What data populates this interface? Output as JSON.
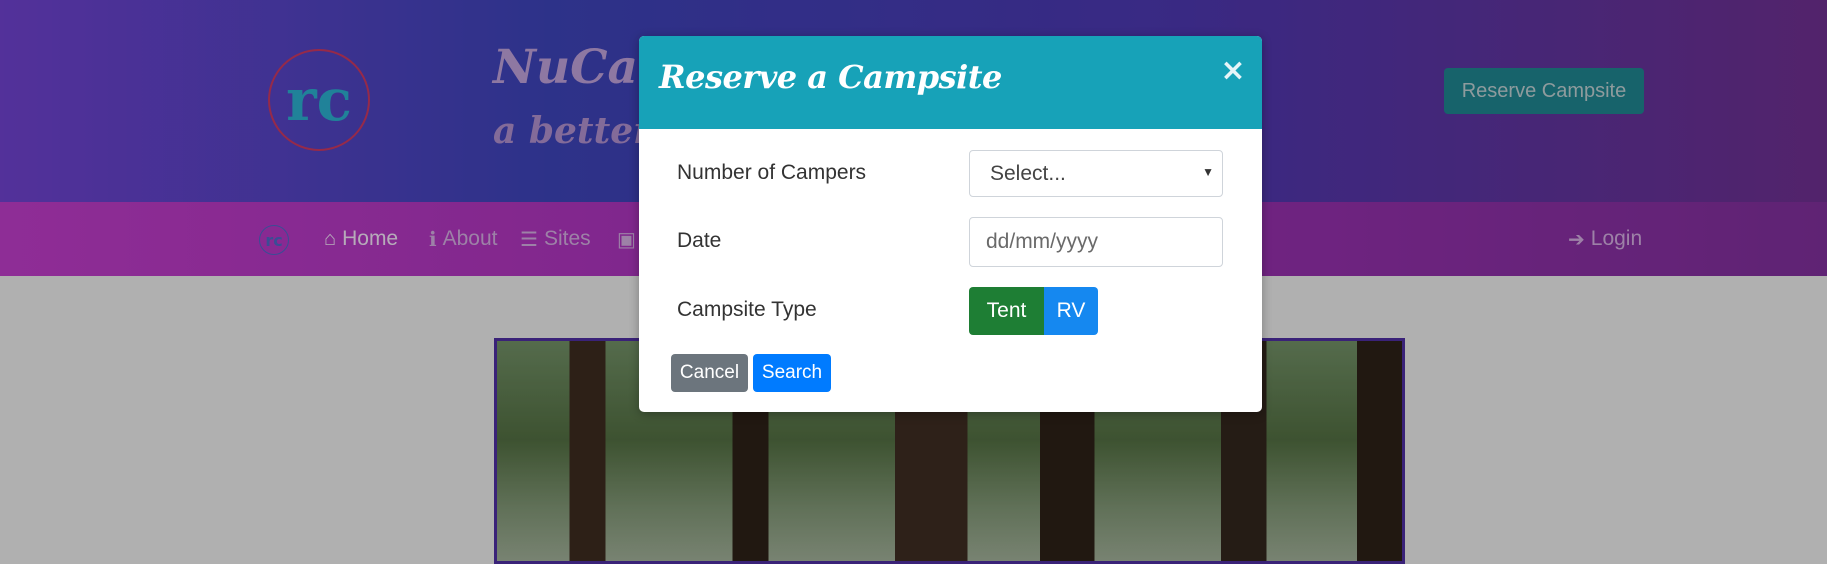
{
  "header": {
    "logo_glyph": "rc",
    "brand_title": "NuCamp",
    "brand_subtitle": "a better w",
    "reserve_button": "Reserve Campsite"
  },
  "nav": {
    "logo_glyph": "rc",
    "items": [
      {
        "icon": "home-icon",
        "glyph": "⌂",
        "label": "Home",
        "active": true
      },
      {
        "icon": "info-icon",
        "glyph": "ℹ",
        "label": "About",
        "active": false
      },
      {
        "icon": "list-icon",
        "glyph": "☰",
        "label": "Sites",
        "active": false
      },
      {
        "icon": "address-card-icon",
        "glyph": "▣",
        "label": "",
        "active": false
      }
    ],
    "login": {
      "icon": "sign-in-icon",
      "glyph": "➔",
      "label": "Login"
    }
  },
  "modal": {
    "title": "Reserve a Campsite",
    "close_glyph": "×",
    "fields": {
      "campers_label": "Number of Campers",
      "campers_value": "Select...",
      "date_label": "Date",
      "date_placeholder": "dd/mm/yyyy",
      "type_label": "Campsite Type",
      "type_options": [
        "Tent",
        "RV"
      ],
      "type_selected": "Tent"
    },
    "cancel_label": "Cancel",
    "search_label": "Search"
  },
  "colors": {
    "modal_header": "#17a2b8",
    "tent_selected": "#1e7e34",
    "rv_button": "#1588f0",
    "cancel": "#6c757d",
    "search": "#007bff",
    "navbar": "#9d2fb0",
    "jumbotron": "#3a40b0"
  }
}
